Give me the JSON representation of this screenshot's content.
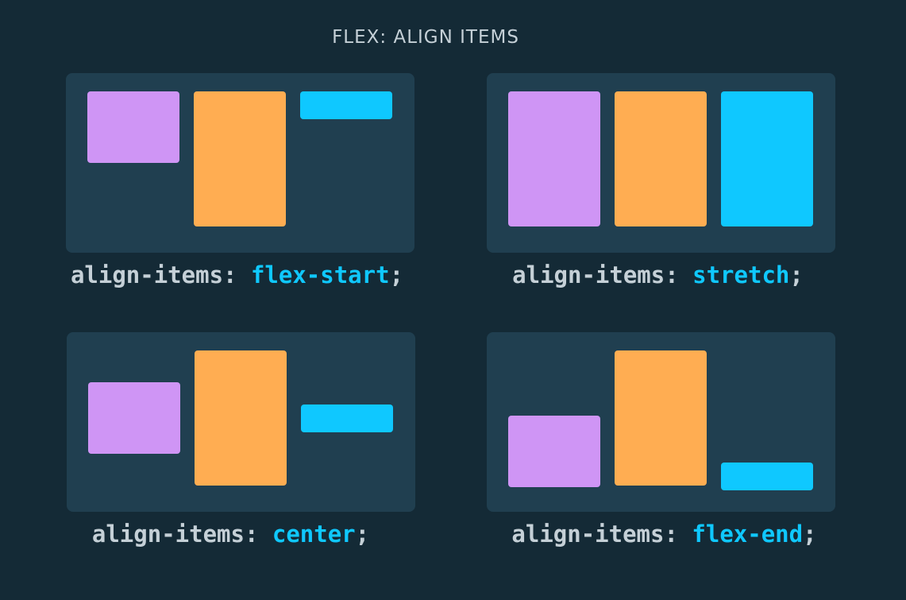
{
  "title": "FLEX: ALIGN ITEMS",
  "colors": {
    "background": "#142a36",
    "panel": "#203f50",
    "item_1": "#cf95f5",
    "item_2": "#ffad52",
    "item_3": "#0fc8ff",
    "keyword": "#0fc8ff",
    "text": "#c5d0d7"
  },
  "examples": [
    {
      "property": "align-items:",
      "value": "flex-start",
      "end": ";"
    },
    {
      "property": "align-items:",
      "value": "stretch",
      "end": ";"
    },
    {
      "property": "align-items:",
      "value": "center",
      "end": ";"
    },
    {
      "property": "align-items:",
      "value": "flex-end",
      "end": ";"
    }
  ]
}
